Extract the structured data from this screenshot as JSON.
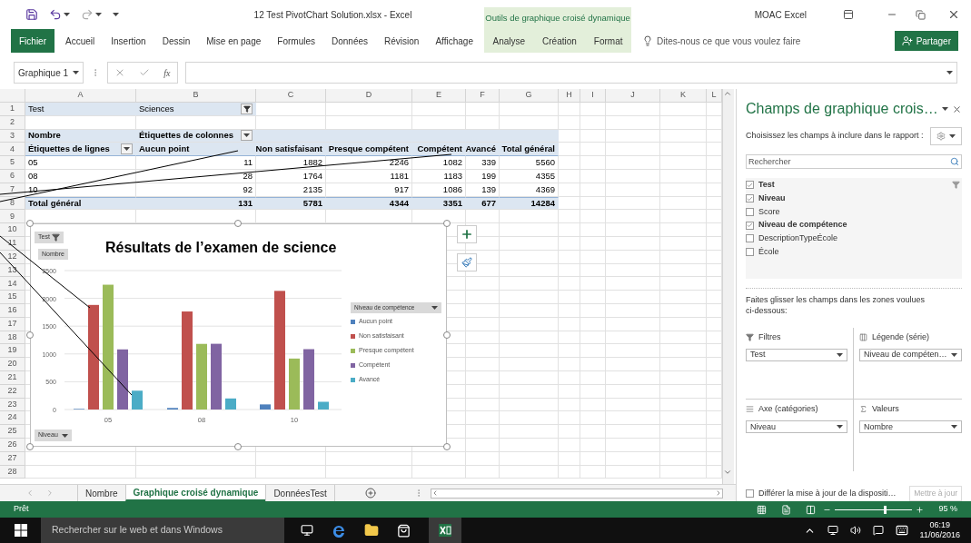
{
  "title_bar": {
    "title": "12 Test PivotChart Solution.xlsx - Excel",
    "context_group": "Outils de graphique croisé dynamique",
    "user": "MOAC Excel"
  },
  "ribbon": {
    "tabs": [
      {
        "label": "Fichier",
        "kind": "file",
        "selected": false
      },
      {
        "label": "Accueil",
        "kind": "normal",
        "selected": false
      },
      {
        "label": "Insertion",
        "kind": "normal",
        "selected": false
      },
      {
        "label": "Dessin",
        "kind": "normal",
        "selected": false
      },
      {
        "label": "Mise en page",
        "kind": "normal",
        "selected": false
      },
      {
        "label": "Formules",
        "kind": "normal",
        "selected": false
      },
      {
        "label": "Données",
        "kind": "normal",
        "selected": false
      },
      {
        "label": "Révision",
        "kind": "normal",
        "selected": false
      },
      {
        "label": "Affichage",
        "kind": "normal",
        "selected": false
      },
      {
        "label": "Analyse",
        "kind": "context",
        "selected": false
      },
      {
        "label": "Création",
        "kind": "context",
        "selected": false
      },
      {
        "label": "Format",
        "kind": "context",
        "selected": false
      }
    ],
    "tell_me": "Dites-nous ce que vous voulez faire",
    "share": "Partager"
  },
  "formula_bar": {
    "name_box": "Graphique 1",
    "fx": "fx"
  },
  "sheet": {
    "columns": [
      "A",
      "B",
      "C",
      "D",
      "E",
      "F",
      "G",
      "H",
      "I",
      "J",
      "K",
      "L"
    ],
    "row_numbers": [
      "1",
      "2",
      "3",
      "4",
      "5",
      "6",
      "7",
      "8",
      "9",
      "10",
      "11",
      "12",
      "13",
      "14",
      "15",
      "16",
      "17",
      "18",
      "19",
      "20",
      "21",
      "22",
      "23",
      "24",
      "25",
      "26",
      "27",
      "28"
    ],
    "pivot": [
      {
        "kind": "filter",
        "cells": [
          "Test",
          "Sciences"
        ]
      },
      {
        "kind": "blank"
      },
      {
        "kind": "col_label",
        "cells": [
          "Nombre",
          "Étiquettes de colonnes"
        ]
      },
      {
        "kind": "header",
        "cells": [
          "Étiquettes de lignes",
          "Aucun point",
          "Non satisfaisant",
          "Presque compétent",
          "Compétent",
          "Avancé",
          "Total général"
        ]
      },
      {
        "kind": "data",
        "cells": [
          "05",
          "11",
          "1882",
          "2246",
          "1082",
          "339",
          "5560"
        ]
      },
      {
        "kind": "data",
        "cells": [
          "08",
          "28",
          "1764",
          "1181",
          "1183",
          "199",
          "4355"
        ]
      },
      {
        "kind": "data",
        "cells": [
          "10",
          "92",
          "2135",
          "917",
          "1086",
          "139",
          "4369"
        ]
      },
      {
        "kind": "total",
        "cells": [
          "Total général",
          "131",
          "5781",
          "4344",
          "3351",
          "677",
          "14284"
        ]
      }
    ]
  },
  "chart": {
    "filter_button": "Test",
    "value_button": "Nombre",
    "axis_button": "Niveau",
    "legend_title": "Niveau de compétence",
    "chart_data": {
      "type": "bar",
      "title": "Résultats de l’examen de science",
      "categories": [
        "05",
        "08",
        "10"
      ],
      "series": [
        {
          "name": "Aucun point",
          "color": "#4f81bd",
          "values": [
            11,
            28,
            92
          ]
        },
        {
          "name": "Non satisfaisant",
          "color": "#c0504d",
          "values": [
            1882,
            1764,
            2135
          ]
        },
        {
          "name": "Presque compétent",
          "color": "#9bbb59",
          "values": [
            2246,
            1181,
            917
          ]
        },
        {
          "name": "Compétent",
          "color": "#8064a2",
          "values": [
            1082,
            1183,
            1086
          ]
        },
        {
          "name": "Avancé",
          "color": "#4bacc6",
          "values": [
            339,
            199,
            139
          ]
        }
      ],
      "grid": true,
      "ylim": [
        0,
        2500
      ],
      "yticks": [
        0,
        500,
        1000,
        1500,
        2000,
        2500
      ]
    }
  },
  "field_pane": {
    "title": "Champs de graphique crois…",
    "instruction": "Choisissez les champs à inclure dans le rapport :",
    "search": {
      "placeholder": "Rechercher"
    },
    "fields": [
      {
        "label": "Test",
        "checked": true
      },
      {
        "label": "Niveau",
        "checked": true
      },
      {
        "label": "Score",
        "checked": false
      },
      {
        "label": "Niveau de compétence",
        "checked": true
      },
      {
        "label": "DescriptionTypeÉcole",
        "checked": false
      },
      {
        "label": "École",
        "checked": false
      }
    ],
    "drag_hint": "Faites glisser les champs dans les zones voulues ci-dessous:",
    "areas": [
      {
        "label": "Filtres",
        "kind": "filters",
        "field": "Test"
      },
      {
        "label": "Légende (série)",
        "kind": "legend",
        "field": "Niveau de compéten…"
      },
      {
        "label": "Axe (catégories)",
        "kind": "axis",
        "field": "Niveau"
      },
      {
        "label": "Valeurs",
        "kind": "values",
        "field": "Nombre"
      }
    ],
    "defer": {
      "label": "Différer la mise à jour de la dispositi…",
      "checked": false
    },
    "update_button": {
      "label": "Mettre à jour",
      "disabled": true
    }
  },
  "sheet_tabs": [
    {
      "label": "Nombre",
      "selected": false
    },
    {
      "label": "Graphique croisé dynamique",
      "selected": true
    },
    {
      "label": "DonnéesTest",
      "selected": false
    }
  ],
  "status_bar": {
    "text": "Prêt",
    "zoom": "95 %",
    "level": 0.63
  },
  "taskbar": {
    "search": "Rechercher sur le web et dans Windows",
    "time": "06:19",
    "date": "11/06/2016"
  }
}
